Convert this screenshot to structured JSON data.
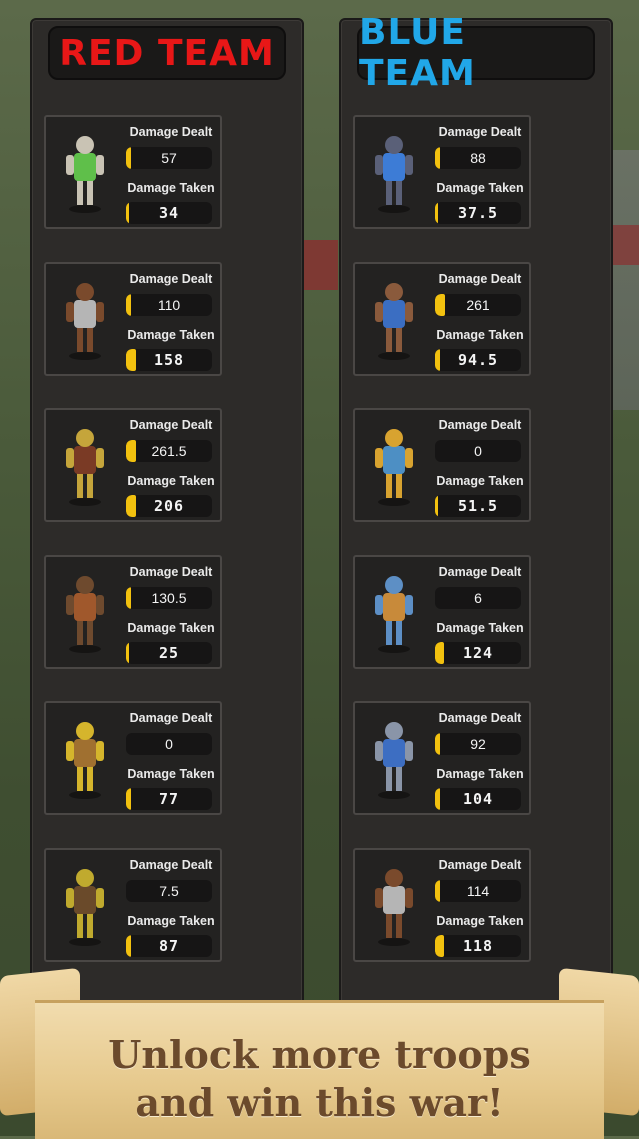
{
  "teams": {
    "red": {
      "title": "RED TEAM",
      "color": "#e81717"
    },
    "blue": {
      "title": "BLUE TEAM",
      "color": "#21a7e8"
    }
  },
  "labels": {
    "damage_dealt": "Damage Dealt",
    "damage_taken": "Damage Taken"
  },
  "red_units": [
    {
      "unit": "golem",
      "dealt": "57",
      "taken": "34",
      "dealt_bar": 0.06,
      "taken_bar": 0.03
    },
    {
      "unit": "horse-rider",
      "dealt": "110",
      "taken": "158",
      "dealt_bar": 0.06,
      "taken_bar": 0.12
    },
    {
      "unit": "axe-shield-warrior",
      "dealt": "261.5",
      "taken": "206",
      "dealt_bar": 0.12,
      "taken_bar": 0.12
    },
    {
      "unit": "spear-shield-warrior",
      "dealt": "130.5",
      "taken": "25",
      "dealt_bar": 0.06,
      "taken_bar": 0.03
    },
    {
      "unit": "yellow-brute",
      "dealt": "0",
      "taken": "77",
      "dealt_bar": 0,
      "taken_bar": 0.06
    },
    {
      "unit": "club-brute",
      "dealt": "7.5",
      "taken": "87",
      "dealt_bar": 0,
      "taken_bar": 0.06
    }
  ],
  "blue_units": [
    {
      "unit": "armored-knight",
      "dealt": "88",
      "taken": "37.5",
      "dealt_bar": 0.06,
      "taken_bar": 0.03
    },
    {
      "unit": "shield-spearman",
      "dealt": "261",
      "taken": "94.5",
      "dealt_bar": 0.12,
      "taken_bar": 0.06
    },
    {
      "unit": "yellow-brawler",
      "dealt": "0",
      "taken": "51.5",
      "dealt_bar": 0,
      "taken_bar": 0.03
    },
    {
      "unit": "club-warrior",
      "dealt": "6",
      "taken": "124",
      "dealt_bar": 0,
      "taken_bar": 0.1
    },
    {
      "unit": "axe-shield-knight",
      "dealt": "92",
      "taken": "104",
      "dealt_bar": 0.06,
      "taken_bar": 0.06
    },
    {
      "unit": "horse-rider",
      "dealt": "114",
      "taken": "118",
      "dealt_bar": 0.06,
      "taken_bar": 0.1
    }
  ],
  "banner": {
    "line1": "Unlock more troops",
    "line2": "and win this war!"
  }
}
